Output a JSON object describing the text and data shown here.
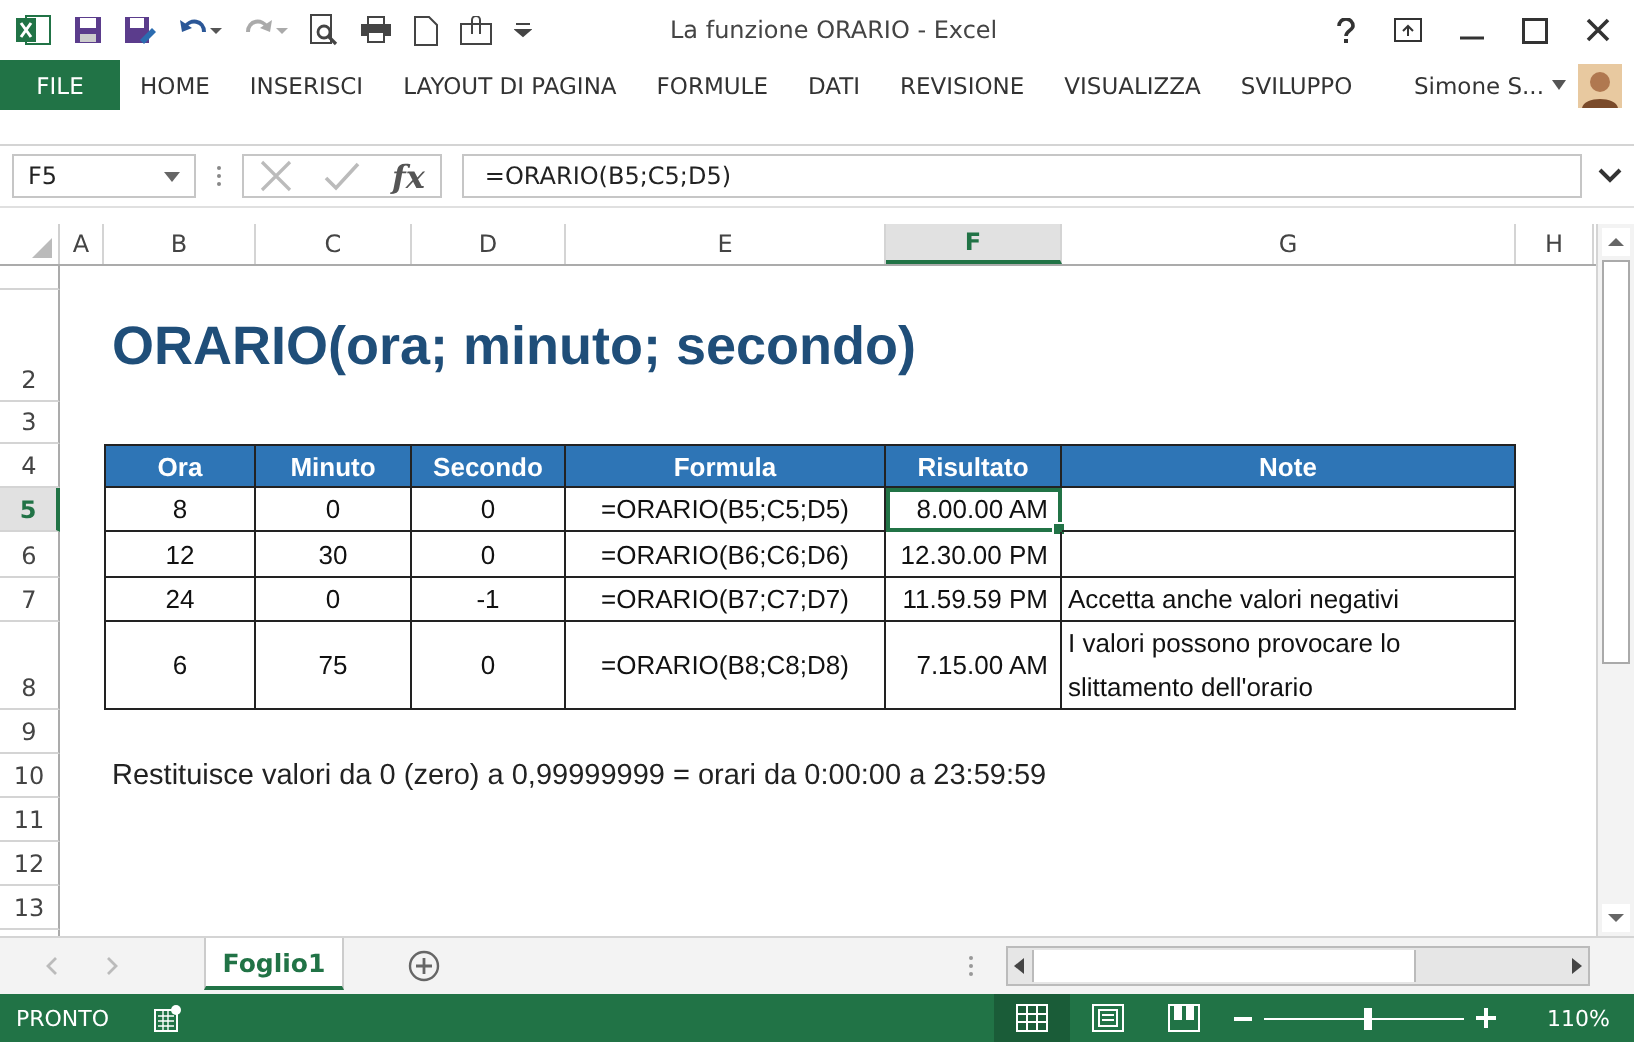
{
  "window": {
    "title": "La funzione ORARIO - Excel"
  },
  "ribbon": {
    "file_tab": "FILE",
    "tabs": [
      {
        "label": "HOME",
        "selected": false
      },
      {
        "label": "INSERISCI",
        "selected": false
      },
      {
        "label": "LAYOUT DI PAGINA",
        "selected": false
      },
      {
        "label": "FORMULE",
        "selected": false
      },
      {
        "label": "DATI",
        "selected": false
      },
      {
        "label": "REVISIONE",
        "selected": false
      },
      {
        "label": "VISUALIZZA",
        "selected": false
      },
      {
        "label": "SVILUPPO",
        "selected": false
      }
    ],
    "user": "Simone S..."
  },
  "formula_bar": {
    "name_box": "F5",
    "function_label": "fx",
    "formula": "=ORARIO(B5;C5;D5)"
  },
  "columns": [
    {
      "label": "A",
      "selected": false
    },
    {
      "label": "B",
      "selected": false
    },
    {
      "label": "C",
      "selected": false
    },
    {
      "label": "D",
      "selected": false
    },
    {
      "label": "E",
      "selected": false
    },
    {
      "label": "F",
      "selected": true
    },
    {
      "label": "G",
      "selected": false
    },
    {
      "label": "H",
      "selected": false
    }
  ],
  "rows": [
    {
      "label": "2",
      "selected": false
    },
    {
      "label": "3",
      "selected": false
    },
    {
      "label": "4",
      "selected": false
    },
    {
      "label": "5",
      "selected": true
    },
    {
      "label": "6",
      "selected": false
    },
    {
      "label": "7",
      "selected": false
    },
    {
      "label": "8",
      "selected": false
    },
    {
      "label": "9",
      "selected": false
    },
    {
      "label": "10",
      "selected": false
    },
    {
      "label": "11",
      "selected": false
    },
    {
      "label": "12",
      "selected": false
    },
    {
      "label": "13",
      "selected": false
    }
  ],
  "heading": "ORARIO(ora; minuto; secondo)",
  "table": {
    "columns": [
      "Ora",
      "Minuto",
      "Secondo",
      "Formula",
      "Risultato",
      "Note"
    ],
    "rows": [
      {
        "cells": [
          {
            "text": "8",
            "selected": false
          },
          {
            "text": "0",
            "selected": false
          },
          {
            "text": "0",
            "selected": false
          },
          {
            "text": "=ORARIO(B5;C5;D5)",
            "selected": false
          },
          {
            "text": "8.00.00 AM",
            "selected": true
          },
          {
            "selected": false
          }
        ]
      },
      {
        "cells": [
          {
            "text": "12",
            "selected": false
          },
          {
            "text": "30",
            "selected": false
          },
          {
            "text": "0",
            "selected": false
          },
          {
            "text": "=ORARIO(B6;C6;D6)",
            "selected": false
          },
          {
            "text": "12.30.00 PM",
            "selected": false
          },
          {
            "selected": false
          }
        ]
      },
      {
        "cells": [
          {
            "text": "24",
            "selected": false
          },
          {
            "text": "0",
            "selected": false
          },
          {
            "text": "-1",
            "selected": false
          },
          {
            "text": "=ORARIO(B7;C7;D7)",
            "selected": false
          },
          {
            "text": "11.59.59 PM",
            "selected": false
          },
          {
            "text": "Accetta anche valori negativi",
            "selected": false
          }
        ]
      },
      {
        "cells": [
          {
            "text": "6",
            "selected": false
          },
          {
            "text": "75",
            "selected": false
          },
          {
            "text": "0",
            "selected": false
          },
          {
            "text": "=ORARIO(B8;C8;D8)",
            "selected": false
          },
          {
            "text": "7.15.00 AM",
            "selected": false
          },
          {
            "text": "I valori possono provocare lo slittamento dell'orario",
            "selected": false
          }
        ]
      }
    ]
  },
  "note": "Restituisce valori da 0 (zero) a 0,99999999 = orari da 0:00:00 a 23:59:59",
  "sheet_tabs": [
    {
      "label": "Foglio1",
      "selected": true
    }
  ],
  "status_bar": {
    "status": "PRONTO",
    "views": [
      {
        "kind": "normal",
        "selected": true
      },
      {
        "kind": "layout",
        "selected": false
      },
      {
        "kind": "pagebreak",
        "selected": false
      }
    ],
    "zoom": {
      "level": 0.52,
      "reading": "110%"
    }
  }
}
